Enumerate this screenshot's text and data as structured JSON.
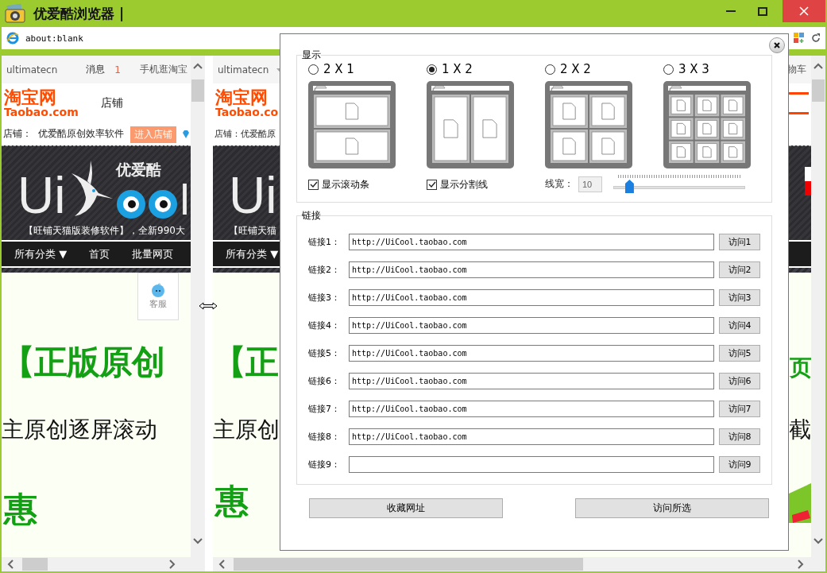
{
  "window": {
    "title": "优爱酷浏览器 |"
  },
  "address_bar": {
    "value": "about:blank"
  },
  "left_pane": {
    "nav": {
      "user": "ultimatecn",
      "messages": "消息",
      "message_count": "1",
      "mobile": "手机逛淘宝"
    },
    "logo": {
      "name": "淘宝网",
      "domain": "Taobao.com"
    },
    "header_label": "店铺",
    "shop": {
      "label": "店铺：",
      "name": "优爱酷原创效率软件",
      "button": "进入店铺"
    },
    "banner": {
      "brand": "Ui",
      "brand_cn": "优爱酷",
      "brand_end": "l",
      "slogan": "【旺铺天猫版装修软件】，全新990大"
    },
    "menu": [
      "所有分类 ▼",
      "首页",
      "批量网页"
    ],
    "service": "客服",
    "headline": "【正版原创",
    "subtitle": "主原创逐屏滚动",
    "promo": "惠"
  },
  "right_pane": {
    "brand": "Ui",
    "nav_user": "ultimatecn",
    "nav_right": "物车",
    "logo": {
      "name": "淘宝网",
      "domain": "Taobao.co"
    },
    "shop": "店铺：优爱酷原",
    "slogan": "【旺铺天猫",
    "menu": "所有分类 ▼",
    "headline_left": "【正",
    "headline_right": "页",
    "subtitle_left": "主原创",
    "subtitle_right": "截",
    "promo": "惠"
  },
  "dialog": {
    "display": {
      "title": "显示",
      "layouts": [
        {
          "label": "2 X 1",
          "kind": "rows",
          "selected": false
        },
        {
          "label": "1 X 2",
          "kind": "cols",
          "selected": true
        },
        {
          "label": "2 X 2",
          "kind": "grid2",
          "selected": false
        },
        {
          "label": "3 X 3",
          "kind": "grid3",
          "selected": false
        }
      ],
      "options": [
        {
          "label": "显示滚动条",
          "checked": true
        },
        {
          "label": "显示分割线",
          "checked": true
        }
      ],
      "line_width": {
        "label": "线宽：",
        "value": "10",
        "level": 0.12
      }
    },
    "links": {
      "title": "链接",
      "items": [
        {
          "label": "链接1：",
          "value": "http://UiCool.taobao.com",
          "button": "访问1"
        },
        {
          "label": "链接2：",
          "value": "http://UiCool.taobao.com",
          "button": "访问2"
        },
        {
          "label": "链接3：",
          "value": "http://UiCool.taobao.com",
          "button": "访问3"
        },
        {
          "label": "链接4：",
          "value": "http://UiCool.taobao.com",
          "button": "访问4"
        },
        {
          "label": "链接5：",
          "value": "http://UiCool.taobao.com",
          "button": "访问5"
        },
        {
          "label": "链接6：",
          "value": "http://UiCool.taobao.com",
          "button": "访问6"
        },
        {
          "label": "链接7：",
          "value": "http://UiCool.taobao.com",
          "button": "访问7"
        },
        {
          "label": "链接8：",
          "value": "http://UiCool.taobao.com",
          "button": "访问8"
        },
        {
          "label": "链接9：",
          "value": "",
          "button": "访问9"
        }
      ]
    },
    "buttons": [
      "收藏网址",
      "访问所选"
    ]
  }
}
